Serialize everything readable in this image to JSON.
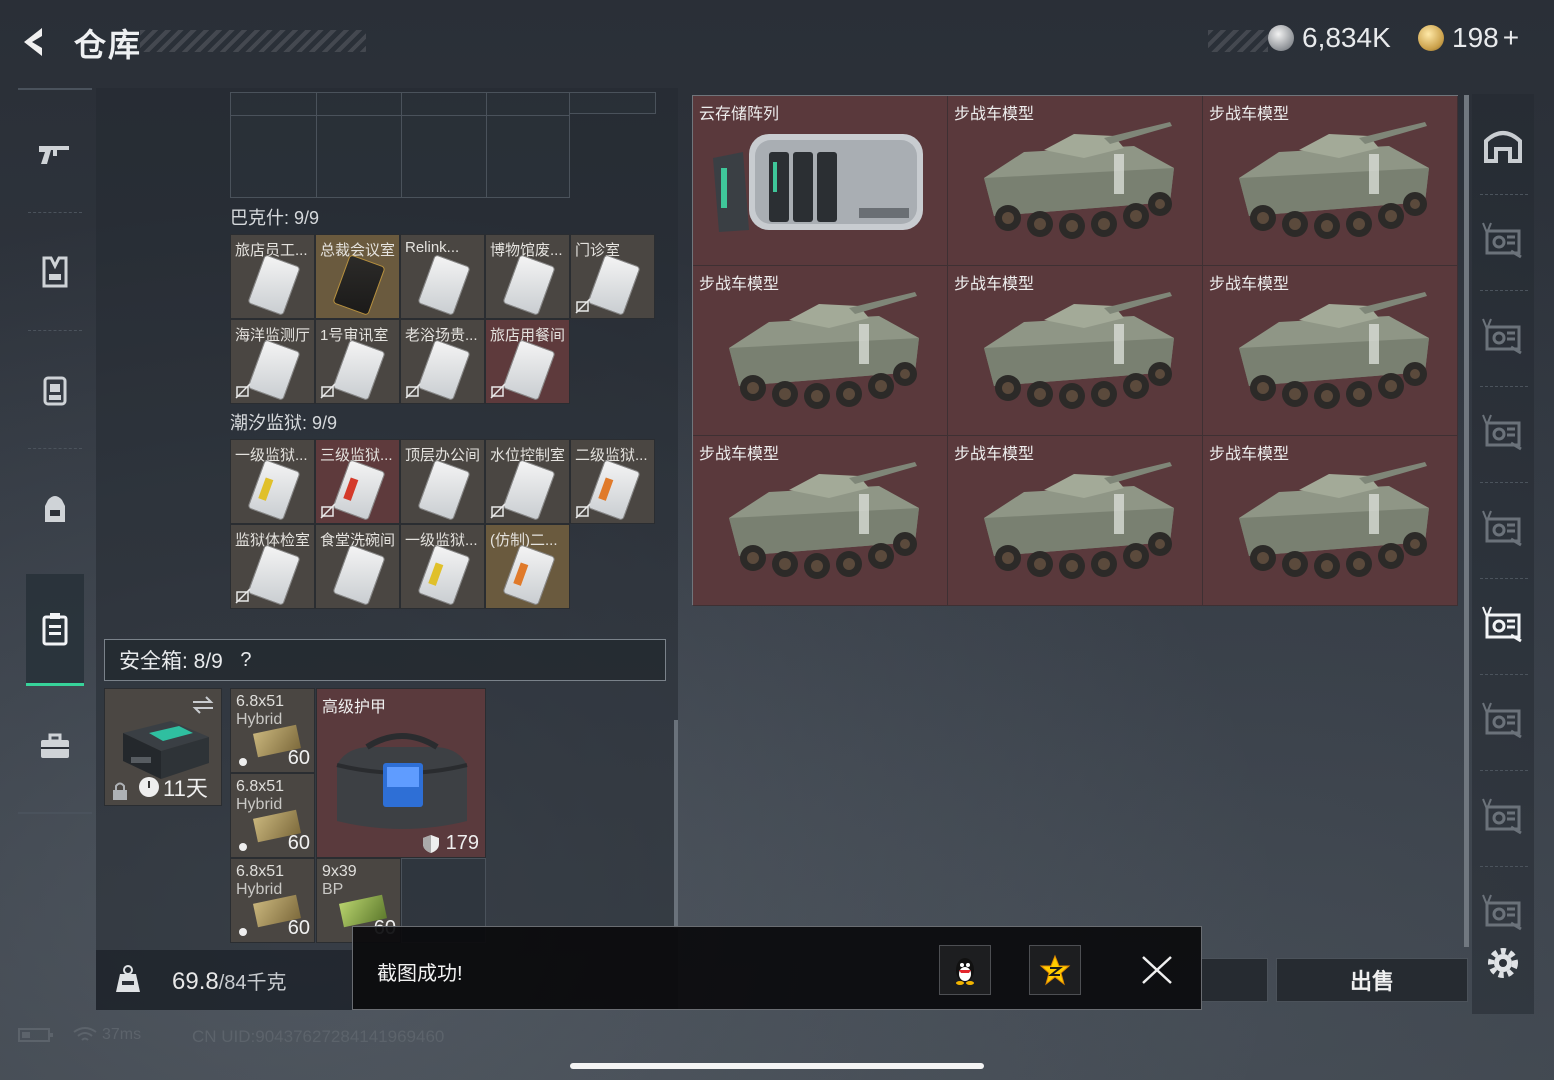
{
  "header": {
    "title": "仓库",
    "silver_amount": "6,834K",
    "gold_amount": "198",
    "plus_label": "+"
  },
  "left_nav": {
    "items": [
      {
        "icon": "gun-icon"
      },
      {
        "icon": "vest-icon"
      },
      {
        "icon": "chest-rig-icon"
      },
      {
        "icon": "backpack-icon"
      },
      {
        "icon": "keycard-case-icon",
        "active": true
      },
      {
        "icon": "briefcase-icon"
      }
    ]
  },
  "key_sections": [
    {
      "label": "巴克什: 9/9",
      "cards": [
        {
          "name": "旅店员工...",
          "card": "white",
          "nobind": false
        },
        {
          "name": "总裁会议室",
          "card": "black",
          "nobind": false,
          "bg": "gold"
        },
        {
          "name": "Relink...",
          "card": "white",
          "nobind": false
        },
        {
          "name": "博物馆废...",
          "card": "white",
          "nobind": false
        },
        {
          "name": "门诊室",
          "card": "white",
          "nobind": true
        },
        {
          "name": "海洋监测厅",
          "card": "white",
          "nobind": true
        },
        {
          "name": "1号审讯室",
          "card": "white",
          "nobind": true
        },
        {
          "name": "老浴场贵...",
          "card": "white",
          "nobind": true
        },
        {
          "name": "旅店用餐间",
          "card": "white",
          "nobind": true,
          "bg": "red"
        }
      ]
    },
    {
      "label": "潮汐监狱: 9/9",
      "cards": [
        {
          "name": "一级监狱...",
          "card": "white",
          "stripe": "#e0c02a",
          "nobind": false
        },
        {
          "name": "三级监狱...",
          "card": "white",
          "stripe": "#d43a2a",
          "nobind": true,
          "bg": "red"
        },
        {
          "name": "顶层办公间",
          "card": "white",
          "nobind": false
        },
        {
          "name": "水位控制室",
          "card": "white",
          "nobind": true
        },
        {
          "name": "二级监狱...",
          "card": "white",
          "stripe": "#e07a2a",
          "nobind": true
        },
        {
          "name": "监狱体检室",
          "card": "white",
          "nobind": true
        },
        {
          "name": "食堂洗碗间",
          "card": "white",
          "nobind": false
        },
        {
          "name": "一级监狱...",
          "card": "white",
          "stripe": "#e0c02a",
          "nobind": false
        },
        {
          "name": "(仿制)二...",
          "card": "white",
          "stripe": "#e07a2a",
          "nobind": false,
          "bg": "gold"
        }
      ]
    }
  ],
  "safebox": {
    "label": "安全箱: 8/9",
    "help": "?",
    "case_time": "11天",
    "ammo": [
      {
        "line1": "6.8x51",
        "line2": "Hybrid",
        "qty": "60"
      },
      {
        "line1": "6.8x51",
        "line2": "Hybrid",
        "qty": "60"
      },
      {
        "line1": "6.8x51",
        "line2": "Hybrid",
        "qty": "60"
      },
      {
        "line1": "9x39",
        "line2": "BP",
        "qty": "60"
      }
    ],
    "armor_name": "高级护甲",
    "armor_durability": "179"
  },
  "weight": {
    "current": "69.8",
    "capacity": "/84千克"
  },
  "storage": {
    "items": [
      {
        "name": "云存储阵列",
        "kind": "server"
      },
      {
        "name": "步战车模型",
        "kind": "ifv"
      },
      {
        "name": "步战车模型",
        "kind": "ifv"
      },
      {
        "name": "步战车模型",
        "kind": "ifv"
      },
      {
        "name": "步战车模型",
        "kind": "ifv"
      },
      {
        "name": "步战车模型",
        "kind": "ifv"
      },
      {
        "name": "步战车模型",
        "kind": "ifv"
      },
      {
        "name": "步战车模型",
        "kind": "ifv"
      },
      {
        "name": "步战车模型",
        "kind": "ifv"
      }
    ]
  },
  "right_tabs": [
    "home-icon",
    "storage-tab-icon",
    "storage-tab-icon",
    "storage-tab-icon",
    "storage-tab-icon",
    "storage-tab-icon-active",
    "storage-tab-icon",
    "storage-tab-icon",
    "storage-tab-icon"
  ],
  "buttons": {
    "sell": "出售"
  },
  "toast": {
    "text": "截图成功!"
  },
  "status": {
    "ping": "37ms",
    "uid": "CN UID:90437627284141969460"
  },
  "colors": {
    "accent": "#37d39a",
    "item_red": "#5a393c",
    "item_brown": "#4a4642"
  }
}
